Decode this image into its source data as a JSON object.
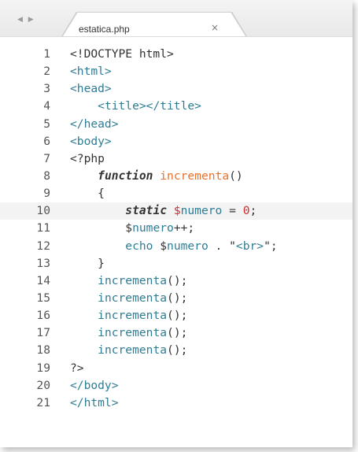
{
  "tab": {
    "nav": "◀ ▶",
    "title": "estatica.php",
    "close": "×"
  },
  "editor": {
    "current_line": 10,
    "lines": [
      {
        "n": "1",
        "tokens": [
          {
            "t": "<!DOCTYPE html>",
            "c": "plain"
          }
        ]
      },
      {
        "n": "2",
        "tokens": [
          {
            "t": "<html>",
            "c": "tag"
          }
        ]
      },
      {
        "n": "3",
        "tokens": [
          {
            "t": "<head>",
            "c": "tag"
          }
        ]
      },
      {
        "n": "4",
        "tokens": [
          {
            "t": "    ",
            "c": "plain"
          },
          {
            "t": "<title></title>",
            "c": "tag"
          }
        ]
      },
      {
        "n": "5",
        "tokens": [
          {
            "t": "</head>",
            "c": "tag"
          }
        ]
      },
      {
        "n": "6",
        "tokens": [
          {
            "t": "<body>",
            "c": "tag"
          }
        ]
      },
      {
        "n": "7",
        "tokens": [
          {
            "t": "<?php",
            "c": "plain"
          }
        ]
      },
      {
        "n": "8",
        "tokens": [
          {
            "t": "    ",
            "c": "plain"
          },
          {
            "t": "function",
            "c": "kw"
          },
          {
            "t": " ",
            "c": "plain"
          },
          {
            "t": "incrementa",
            "c": "fn"
          },
          {
            "t": "()",
            "c": "plain"
          }
        ]
      },
      {
        "n": "9",
        "tokens": [
          {
            "t": "    {",
            "c": "plain"
          }
        ]
      },
      {
        "n": "10",
        "tokens": [
          {
            "t": "        ",
            "c": "plain"
          },
          {
            "t": "static",
            "c": "kw"
          },
          {
            "t": " ",
            "c": "plain"
          },
          {
            "t": "$",
            "c": "dollar"
          },
          {
            "t": "numero",
            "c": "var"
          },
          {
            "t": " = ",
            "c": "plain"
          },
          {
            "t": "0",
            "c": "num"
          },
          {
            "t": ";",
            "c": "plain"
          }
        ]
      },
      {
        "n": "11",
        "tokens": [
          {
            "t": "        ",
            "c": "plain"
          },
          {
            "t": "$",
            "c": "plain"
          },
          {
            "t": "numero",
            "c": "var"
          },
          {
            "t": "++;",
            "c": "plain"
          }
        ]
      },
      {
        "n": "12",
        "tokens": [
          {
            "t": "        ",
            "c": "plain"
          },
          {
            "t": "echo ",
            "c": "call"
          },
          {
            "t": "$",
            "c": "plain"
          },
          {
            "t": "numero",
            "c": "var"
          },
          {
            "t": " . \"",
            "c": "plain"
          },
          {
            "t": "<br>",
            "c": "str"
          },
          {
            "t": "\";",
            "c": "plain"
          }
        ]
      },
      {
        "n": "13",
        "tokens": [
          {
            "t": "    }",
            "c": "plain"
          }
        ]
      },
      {
        "n": "14",
        "tokens": [
          {
            "t": "    ",
            "c": "plain"
          },
          {
            "t": "incrementa",
            "c": "call"
          },
          {
            "t": "();",
            "c": "plain"
          }
        ]
      },
      {
        "n": "15",
        "tokens": [
          {
            "t": "    ",
            "c": "plain"
          },
          {
            "t": "incrementa",
            "c": "call"
          },
          {
            "t": "();",
            "c": "plain"
          }
        ]
      },
      {
        "n": "16",
        "tokens": [
          {
            "t": "    ",
            "c": "plain"
          },
          {
            "t": "incrementa",
            "c": "call"
          },
          {
            "t": "();",
            "c": "plain"
          }
        ]
      },
      {
        "n": "17",
        "tokens": [
          {
            "t": "    ",
            "c": "plain"
          },
          {
            "t": "incrementa",
            "c": "call"
          },
          {
            "t": "();",
            "c": "plain"
          }
        ]
      },
      {
        "n": "18",
        "tokens": [
          {
            "t": "    ",
            "c": "plain"
          },
          {
            "t": "incrementa",
            "c": "call"
          },
          {
            "t": "();",
            "c": "plain"
          }
        ]
      },
      {
        "n": "19",
        "tokens": [
          {
            "t": "?>",
            "c": "plain"
          }
        ]
      },
      {
        "n": "20",
        "tokens": [
          {
            "t": "</body>",
            "c": "tag"
          }
        ]
      },
      {
        "n": "21",
        "tokens": [
          {
            "t": "</html>",
            "c": "tag"
          }
        ]
      }
    ]
  }
}
